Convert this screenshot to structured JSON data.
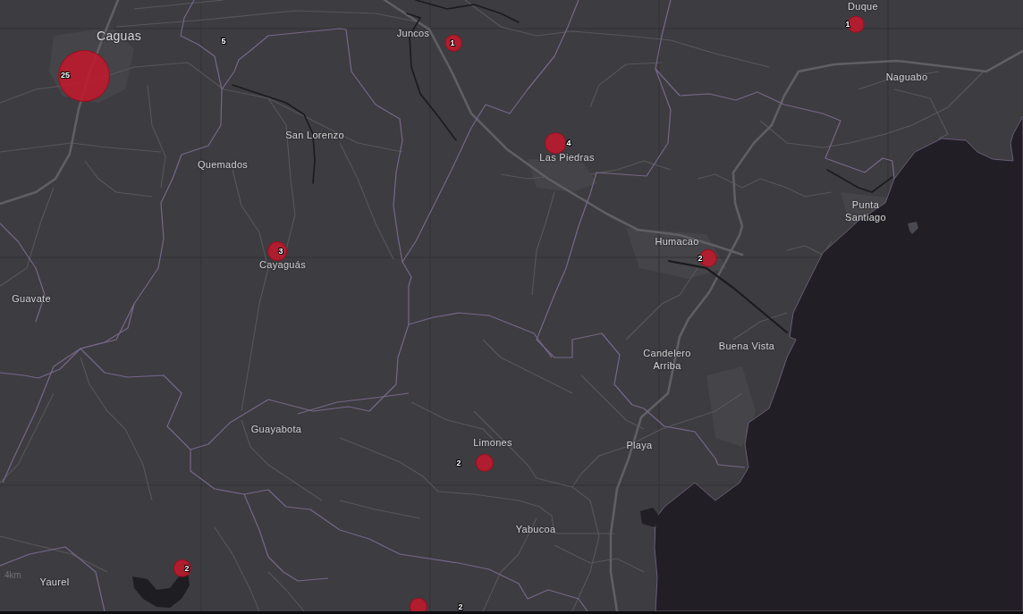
{
  "map": {
    "places": [
      "Duque",
      "Juncos",
      "Caguas",
      "Naguabo",
      "San Lorenzo",
      "Las Piedras",
      "Quemados",
      "Punta Santiago",
      "Humacao",
      "Cayaguás",
      "Guavate",
      "Buena Vista",
      "Candelero Arriba",
      "Guayabota",
      "Limones",
      "Playa",
      "Yabucoa",
      "Yaurel"
    ],
    "clusters": [
      {
        "kind": "marker",
        "count": "1"
      },
      {
        "kind": "label_only",
        "count": "5"
      },
      {
        "kind": "marker",
        "count": "1"
      },
      {
        "kind": "marker",
        "count": "25"
      },
      {
        "kind": "marker",
        "count": "4"
      },
      {
        "kind": "marker",
        "count": "3"
      },
      {
        "kind": "marker",
        "count": "2"
      },
      {
        "kind": "marker",
        "count": "2"
      },
      {
        "kind": "marker",
        "count": "2"
      },
      {
        "kind": "marker",
        "count": "2"
      }
    ],
    "scale_bar": {
      "label": "4km"
    }
  }
}
